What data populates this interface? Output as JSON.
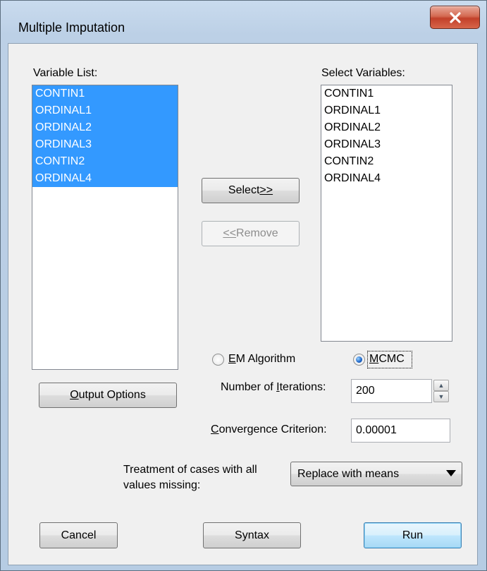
{
  "window": {
    "title": "Multiple Imputation"
  },
  "variable_list": {
    "label": "Variable List:",
    "items": [
      {
        "label": "CONTIN1",
        "selected": true
      },
      {
        "label": "ORDINAL1",
        "selected": true
      },
      {
        "label": "ORDINAL2",
        "selected": true
      },
      {
        "label": "ORDINAL3",
        "selected": true
      },
      {
        "label": "CONTIN2",
        "selected": true
      },
      {
        "label": "ORDINAL4",
        "selected": true
      }
    ]
  },
  "select_variables": {
    "label": "Select Variables:",
    "items": [
      "CONTIN1",
      "ORDINAL1",
      "ORDINAL2",
      "ORDINAL3",
      "CONTIN2",
      "ORDINAL4"
    ]
  },
  "buttons": {
    "select": {
      "text": "Select ",
      "mnemonic": ">>"
    },
    "remove": {
      "mnemonic": "<<",
      "text": " Remove"
    },
    "output_options": {
      "mnemonic": "O",
      "text": "utput Options"
    },
    "cancel": "Cancel",
    "syntax": "Syntax",
    "run": "Run"
  },
  "method": {
    "em": {
      "mnemonic": "E",
      "text": "M Algorithm",
      "checked": false
    },
    "mcmc": {
      "mnemonic": "M",
      "text": "CMC",
      "checked": true
    }
  },
  "iterations": {
    "label_pre": "Number of ",
    "mnemonic": "I",
    "label_post": "terations:",
    "value": "200"
  },
  "convergence": {
    "mnemonic": "C",
    "label_post": "onvergence Criterion:",
    "value": "0.00001"
  },
  "treatment": {
    "label_line1": "Treatment of cases with all",
    "label_line2": "values missing:",
    "selected": "Replace with means"
  },
  "colors": {
    "selection": "#3399ff",
    "close_button": "#c7432c"
  },
  "icons": {
    "close": "close-x-icon",
    "dropdown": "triangle-down-icon",
    "spin_up": "triangle-up-icon",
    "spin_down": "triangle-down-icon"
  }
}
